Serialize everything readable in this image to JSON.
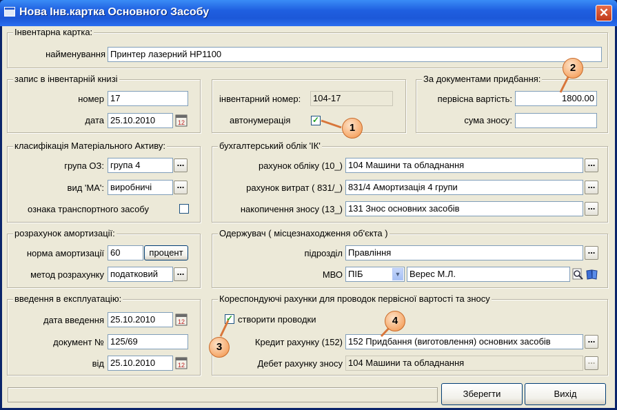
{
  "window": {
    "title": "Нова Інв.картка Основного Засобу",
    "close_glyph": "✕"
  },
  "inv_card": {
    "legend": "Інвентарна картка:",
    "name_label": "найменування",
    "name_value": "Принтер лазерний HP1100"
  },
  "inv_book": {
    "legend": "запис в інвентарній книзі",
    "number_label": "номер",
    "number_value": "17",
    "date_label": "дата",
    "date_value": "25.10.2010",
    "inv_number_label": "інвентарний номер:",
    "inv_number_value": "104-17",
    "autonum_label": "автонумерація",
    "autonum_checked": true
  },
  "acquisition": {
    "legend": "За документами придбання:",
    "cost_label": "первісна вартість:",
    "cost_value": "1800.00",
    "depr_sum_label": "сума зносу:",
    "depr_sum_value": ""
  },
  "classification": {
    "legend": "класифікація Матеріального Активу:",
    "group_label": "група ОЗ:",
    "group_value": "група 4",
    "kind_label": "вид 'МА':",
    "kind_value": "виробничі",
    "transport_label": "ознака транспортного засобу",
    "transport_checked": false
  },
  "accounting": {
    "legend": "бухгалтерський облік 'ІК'",
    "account_label": "рахунок обліку   (10_)",
    "account_value": "104 Машини та обладнання",
    "expense_label": "рахунок витрат   ( 831/_)",
    "expense_value": "831/4 Амортизація 4 групи",
    "accum_label": "накопичення зносу   (13_)",
    "accum_value": "131 Знос основних засобів"
  },
  "depreciation": {
    "legend": "розрахунок амортизації:",
    "rate_label": "норма амортизації",
    "rate_value": "60",
    "percent_button": "процент",
    "method_label": "метод розрахунку",
    "method_value": "податковий"
  },
  "recipient": {
    "legend": "Одержувач ( місцезнаходження об'єкта )",
    "dept_label": "підрозділ",
    "dept_value": "Правління",
    "mvo_label": "МВО",
    "mvo_type": "ПІБ",
    "mvo_value": "Верес М.Л."
  },
  "commissioning": {
    "legend": "введення в експлуатацію:",
    "date_label": "дата введення",
    "date_value": "25.10.2010",
    "doc_label": "документ №",
    "doc_value": "125/69",
    "from_label": "від",
    "from_value": "25.10.2010"
  },
  "correspondence": {
    "legend": "Кореспондуючі рахунки для проводок первісної вартості та зносу",
    "create_label": "створити проводки",
    "create_checked": true,
    "credit_label": "Кредит рахунку (152)",
    "credit_value": "152 Придбання (виготовлення) основних засобів",
    "debit_label": "Дебет рахунку зносу",
    "debit_value": "104 Машини та обладнання"
  },
  "buttons": {
    "save": "Зберегти",
    "exit": "Вихід",
    "dots": "...",
    "dropdown": "▼"
  },
  "callouts": [
    "1",
    "2",
    "3",
    "4"
  ],
  "icons": {
    "check": "✓",
    "calendar": "calendar-icon",
    "search": "search-icon",
    "book": "book-icon"
  }
}
